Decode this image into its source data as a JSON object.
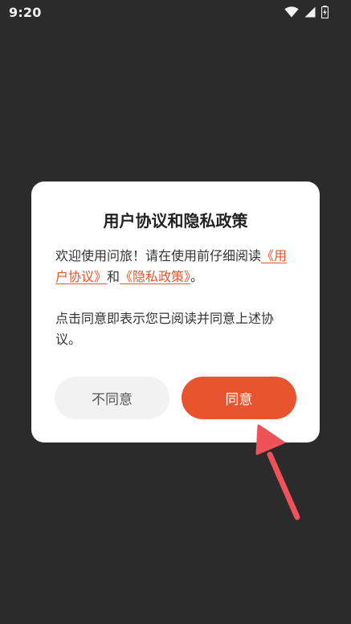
{
  "status_bar": {
    "time": "9:20",
    "icons": [
      "wifi-icon",
      "signal-icon",
      "battery-icon"
    ]
  },
  "dialog": {
    "title": "用户协议和隐私政策",
    "paragraph1_prefix": "欢迎使用问旅！请在使用前仔细阅读",
    "user_agreement_link": "《用户协议》",
    "connector": "和",
    "privacy_policy_link": "《隐私政策》",
    "paragraph1_suffix": "。",
    "paragraph2": "点击同意即表示您已阅读并同意上述协议。",
    "disagree_label": "不同意",
    "agree_label": "同意"
  },
  "colors": {
    "background": "#2b2b2b",
    "accent": "#e8542e",
    "arrow": "#f0525a"
  }
}
